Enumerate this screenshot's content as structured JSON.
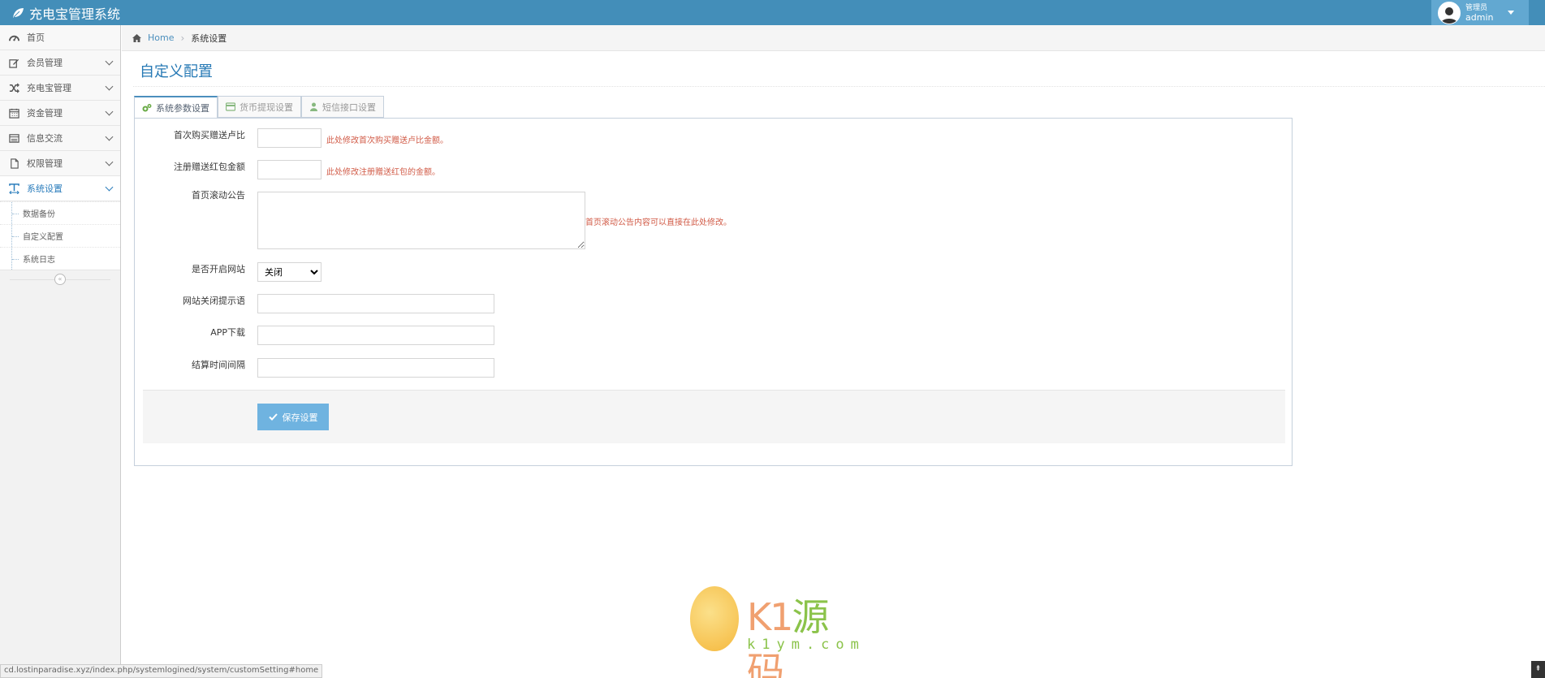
{
  "app": {
    "title": "充电宝管理系统"
  },
  "user": {
    "role": "管理员",
    "name": "admin"
  },
  "sidebar": {
    "items": [
      {
        "label": "首页",
        "icon": "dashboard-icon",
        "has_arrow": false
      },
      {
        "label": "会员管理",
        "icon": "edit-icon",
        "has_arrow": true
      },
      {
        "label": "充电宝管理",
        "icon": "shuffle-icon",
        "has_arrow": true
      },
      {
        "label": "资金管理",
        "icon": "calendar-icon",
        "has_arrow": true
      },
      {
        "label": "信息交流",
        "icon": "list-alt-icon",
        "has_arrow": true
      },
      {
        "label": "权限管理",
        "icon": "file-icon",
        "has_arrow": true
      },
      {
        "label": "系统设置",
        "icon": "text-width-icon",
        "has_arrow": true,
        "active": true
      }
    ],
    "submenu": [
      "数据备份",
      "自定义配置",
      "系统日志"
    ]
  },
  "breadcrumb": {
    "home": "Home",
    "current": "系统设置"
  },
  "page": {
    "title": "自定义配置"
  },
  "tabs": [
    {
      "label": "系统参数设置",
      "icon": "cogs-icon",
      "active": true
    },
    {
      "label": "货币提现设置",
      "icon": "credit-card-icon",
      "active": false
    },
    {
      "label": "短信接口设置",
      "icon": "user-icon",
      "active": false
    }
  ],
  "form": {
    "first_buy_label": "首次购买赠送卢比",
    "first_buy_value": "",
    "first_buy_hint": "此处修改首次购买赠送卢比金额。",
    "register_label": "注册赠送红包金额",
    "register_value": "",
    "register_hint": "此处修改注册赠送红包的金额。",
    "notice_label": "首页滚动公告",
    "notice_value": "",
    "notice_hint": "首页滚动公告内容可以直接在此处修改。",
    "site_open_label": "是否开启网站",
    "site_open_value": "关闭",
    "site_closed_msg_label": "网站关闭提示语",
    "site_closed_msg_value": "",
    "app_download_label": "APP下载",
    "app_download_value": "",
    "settle_interval_label": "结算时间间隔",
    "settle_interval_value": "",
    "save_label": "保存设置"
  },
  "watermark": {
    "text_a": "K1",
    "text_b": "源",
    "text_c": "码",
    "url": "k1ym.com"
  },
  "status_bar": {
    "url": "cd.lostinparadise.xyz/index.php/systemlogined/system/customSetting#home"
  },
  "colors": {
    "navbar": "#438eb9",
    "accent": "#2679b5",
    "hint": "#d15b47",
    "button": "#6fb3e0"
  }
}
